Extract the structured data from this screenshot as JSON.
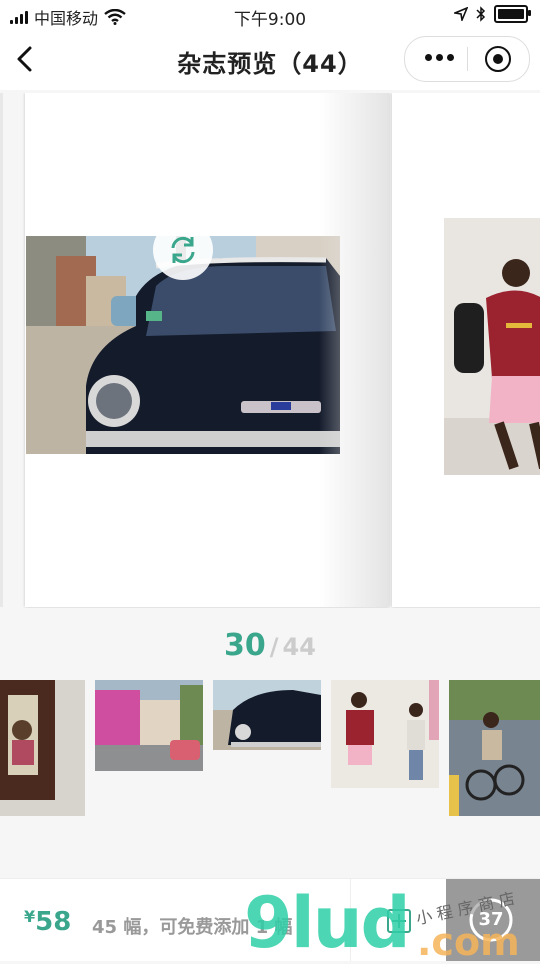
{
  "status_bar": {
    "carrier": "中国移动",
    "time": "下午9:00",
    "battery_level": 0.85
  },
  "nav": {
    "title": "杂志预览（44）"
  },
  "pager": {
    "current": "30",
    "separator": "/",
    "total": "44"
  },
  "bottom_bar": {
    "currency": "¥",
    "price": "58",
    "count_text": "45 幅，可免费添加 1 幅",
    "badge_count": "37"
  },
  "watermark": {
    "brand": "9lud",
    "suffix": ".com",
    "tagline": "小 程 序 商 店"
  },
  "icons": [
    "signal-icon",
    "wifi-icon",
    "location-icon",
    "bluetooth-icon",
    "battery-icon",
    "back-icon",
    "more-icon",
    "target-icon",
    "refresh-icon",
    "add-icon",
    "progress-ring-icon"
  ],
  "colors": {
    "accent": "#3aa68b",
    "muted": "#cccccc",
    "done_button": "#9a9a9a"
  }
}
